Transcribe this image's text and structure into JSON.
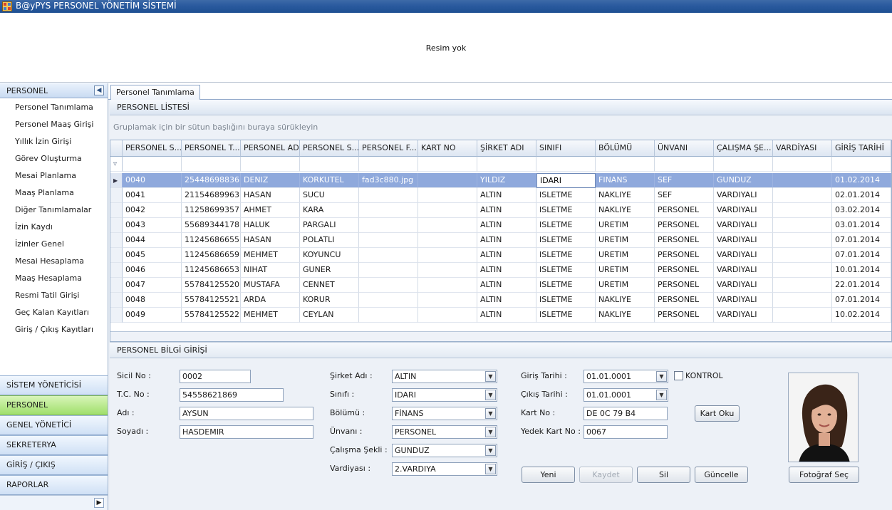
{
  "window": {
    "title": "B@yPYS PERSONEL YÖNETİM SİSTEMİ",
    "app_icon": "app-grid-icon"
  },
  "banner": {
    "no_image_text": "Resim yok"
  },
  "sidebar": {
    "header": "PERSONEL",
    "collapse_icon": "chevron-left-icon",
    "items": [
      {
        "label": "Personel Tanımlama"
      },
      {
        "label": "Personel Maaş Girişi"
      },
      {
        "label": "Yıllık İzin Girişi"
      },
      {
        "label": "Görev Oluşturma"
      },
      {
        "label": "Mesai Planlama"
      },
      {
        "label": "Maaş Planlama"
      },
      {
        "label": "Diğer Tanımlamalar"
      },
      {
        "label": "İzin Kaydı"
      },
      {
        "label": "İzinler Genel"
      },
      {
        "label": "Mesai Hesaplama"
      },
      {
        "label": "Maaş Hesaplama"
      },
      {
        "label": "Resmi Tatil Girişi"
      },
      {
        "label": "Geç Kalan Kayıtları"
      },
      {
        "label": "Giriş / Çıkış Kayıtları"
      }
    ],
    "groups": [
      {
        "label": "SİSTEM YÖNETİCİSİ",
        "active": false
      },
      {
        "label": "PERSONEL",
        "active": true
      },
      {
        "label": "GENEL YÖNETİCİ",
        "active": false
      },
      {
        "label": "SEKRETERYA",
        "active": false
      },
      {
        "label": "GİRİŞ / ÇIKIŞ",
        "active": false
      },
      {
        "label": "RAPORLAR",
        "active": false
      }
    ],
    "footer_icon": "chevron-right-icon"
  },
  "tabs": [
    {
      "label": "Personel Tanımlama",
      "active": true
    }
  ],
  "list": {
    "title": "PERSONEL LİSTESİ",
    "group_hint": "Gruplamak için bir sütun başlığını buraya sürükleyin",
    "columns": [
      "PERSONEL S...",
      "PERSONEL T...",
      "PERSONEL ADI",
      "PERSONEL S...",
      "PERSONEL F...",
      "KART NO",
      "ŞİRKET ADI",
      "SINIFI",
      "BÖLÜMÜ",
      "ÜNVANI",
      "ÇALIŞMA ŞE...",
      "VARDİYASI",
      "GİRİŞ TARİHİ"
    ],
    "filter_icon": "filter-icon",
    "row_indicator_icon": "row-pointer-icon",
    "selected_row": 0,
    "focused_column": 7,
    "rows": [
      [
        "0040",
        "25448698836",
        "DENIZ",
        "KORKUTEL",
        "fad3c880.jpg",
        "",
        "YILDIZ",
        "IDARI",
        "FINANS",
        "SEF",
        "GUNDUZ",
        "",
        "01.02.2014"
      ],
      [
        "0041",
        "21154689963",
        "HASAN",
        "SUCU",
        "",
        "",
        "ALTIN",
        "ISLETME",
        "NAKLIYE",
        "SEF",
        "VARDIYALI",
        "",
        "02.01.2014"
      ],
      [
        "0042",
        "11258699357",
        "AHMET",
        "KARA",
        "",
        "",
        "ALTIN",
        "ISLETME",
        "NAKLIYE",
        "PERSONEL",
        "VARDIYALI",
        "",
        "03.02.2014"
      ],
      [
        "0043",
        "55689344178",
        "HALUK",
        "PARGALI",
        "",
        "",
        "ALTIN",
        "ISLETME",
        "URETIM",
        "PERSONEL",
        "VARDIYALI",
        "",
        "03.01.2014"
      ],
      [
        "0044",
        "11245686655",
        "HASAN",
        "POLATLI",
        "",
        "",
        "ALTIN",
        "ISLETME",
        "URETIM",
        "PERSONEL",
        "VARDIYALI",
        "",
        "07.01.2014"
      ],
      [
        "0045",
        "11245686659",
        "MEHMET",
        "KOYUNCU",
        "",
        "",
        "ALTIN",
        "ISLETME",
        "URETIM",
        "PERSONEL",
        "VARDIYALI",
        "",
        "07.01.2014"
      ],
      [
        "0046",
        "11245686653",
        "NIHAT",
        "GUNER",
        "",
        "",
        "ALTIN",
        "ISLETME",
        "URETIM",
        "PERSONEL",
        "VARDIYALI",
        "",
        "10.01.2014"
      ],
      [
        "0047",
        "55784125520",
        "MUSTAFA",
        "CENNET",
        "",
        "",
        "ALTIN",
        "ISLETME",
        "URETIM",
        "PERSONEL",
        "VARDIYALI",
        "",
        "22.01.2014"
      ],
      [
        "0048",
        "55784125521",
        "ARDA",
        "KORUR",
        "",
        "",
        "ALTIN",
        "ISLETME",
        "NAKLIYE",
        "PERSONEL",
        "VARDIYALI",
        "",
        "07.01.2014"
      ],
      [
        "0049",
        "55784125522",
        "MEHMET",
        "CEYLAN",
        "",
        "",
        "ALTIN",
        "ISLETME",
        "NAKLIYE",
        "PERSONEL",
        "VARDIYALI",
        "",
        "10.02.2014"
      ]
    ]
  },
  "form": {
    "title": "PERSONEL BİLGİ GİRİŞİ",
    "sicil_label": "Sicil No :",
    "sicil_value": "0002",
    "tc_label": "T.C. No :",
    "tc_value": "54558621869",
    "adi_label": "Adı :",
    "adi_value": "AYSUN",
    "soyadi_label": "Soyadı :",
    "soyadi_value": "HASDEMIR",
    "sirket_label": "Şirket Adı :",
    "sirket_value": "ALTIN",
    "sinifi_label": "Sınıfı :",
    "sinifi_value": "IDARI",
    "bolumu_label": "Bölümü :",
    "bolumu_value": "FİNANS",
    "unvani_label": "Ünvanı :",
    "unvani_value": "PERSONEL",
    "calisma_label": "Çalışma Şekli :",
    "calisma_value": "GUNDUZ",
    "vardiya_label": "Vardiyası :",
    "vardiya_value": "2.VARDIYA",
    "giris_label": "Giriş Tarihi :",
    "giris_value": "01.01.0001",
    "cikis_label": "Çıkış Tarihi :",
    "cikis_value": "01.01.0001",
    "kontrol_label": "KONTROL",
    "kontrol_checked": false,
    "kartno_label": "Kart No :",
    "kartno_value": "DE 0C 79 B4",
    "kart_oku_button": "Kart Oku",
    "yedek_label": "Yedek Kart No :",
    "yedek_value": "0067",
    "dropdown_icon": "chevron-down-icon",
    "buttons": {
      "yeni": "Yeni",
      "kaydet": "Kaydet",
      "sil": "Sil",
      "guncelle": "Güncelle",
      "foto_sec": "Fotoğraf Seç"
    },
    "photo_icon": "employee-photo"
  },
  "colors": {
    "selected_row": "#8fa9dc",
    "active_group": "#9fdf6b",
    "titlebar": "#2a5a9e"
  }
}
